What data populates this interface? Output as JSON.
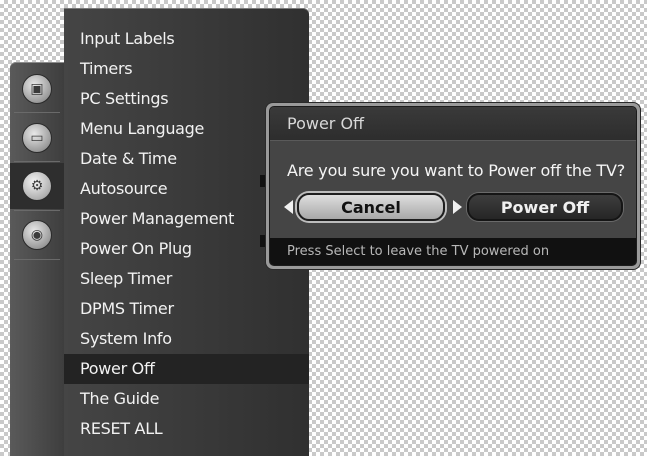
{
  "categories": [
    {
      "icon": "picture-icon",
      "glyph": "▣",
      "active": false
    },
    {
      "icon": "tv-icon",
      "glyph": "▭",
      "active": false
    },
    {
      "icon": "gears-icon",
      "glyph": "⚙",
      "active": true
    },
    {
      "icon": "camera-icon",
      "glyph": "◉",
      "active": false
    }
  ],
  "menu": {
    "items": [
      "Input Labels",
      "Timers",
      "PC Settings",
      "Menu Language",
      "Date & Time",
      "Autosource",
      "Power Management",
      "Power On Plug",
      "Sleep Timer",
      "DPMS Timer",
      "System Info",
      "Power Off",
      "The Guide",
      "RESET ALL"
    ],
    "selected": "Power Off"
  },
  "dialog": {
    "title": "Power Off",
    "message": "Are you sure you want to Power off the TV?",
    "cancel_label": "Cancel",
    "confirm_label": "Power Off",
    "footer": "Press Select to leave the TV powered on"
  }
}
